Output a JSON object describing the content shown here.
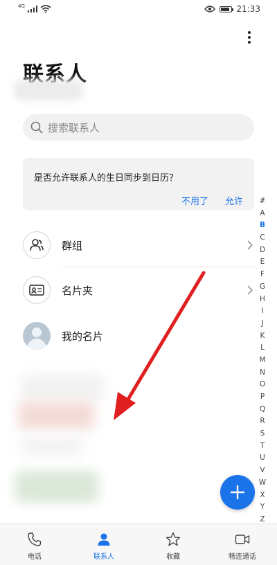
{
  "status_bar": {
    "signal_tag": "4G",
    "time": "21:33",
    "battery_level_pct": 80
  },
  "header": {
    "title": "联系人",
    "more_icon": "more-vertical-icon"
  },
  "search": {
    "placeholder": "搜索联系人"
  },
  "prompt": {
    "message": "是否允许联系人的生日同步到日历？",
    "decline_label": "不用了",
    "allow_label": "允许"
  },
  "rows": {
    "groups_label": "群组",
    "cards_label": "名片夹",
    "my_card_label": "我的名片"
  },
  "alpha_index": [
    "#",
    "A",
    "B",
    "C",
    "D",
    "E",
    "F",
    "G",
    "H",
    "I",
    "J",
    "K",
    "L",
    "M",
    "N",
    "O",
    "P",
    "Q",
    "R",
    "S",
    "T",
    "U",
    "V",
    "W",
    "X",
    "Y",
    "Z"
  ],
  "alpha_active": "B",
  "bottom_nav": [
    {
      "label": "电话",
      "icon": "phone-icon"
    },
    {
      "label": "联系人",
      "icon": "contacts-person-icon"
    },
    {
      "label": "收藏",
      "icon": "star-icon"
    },
    {
      "label": "畅连通话",
      "icon": "video-call-icon"
    }
  ],
  "colors": {
    "accent": "#1a73e8",
    "annotation_arrow": "#e02020"
  }
}
